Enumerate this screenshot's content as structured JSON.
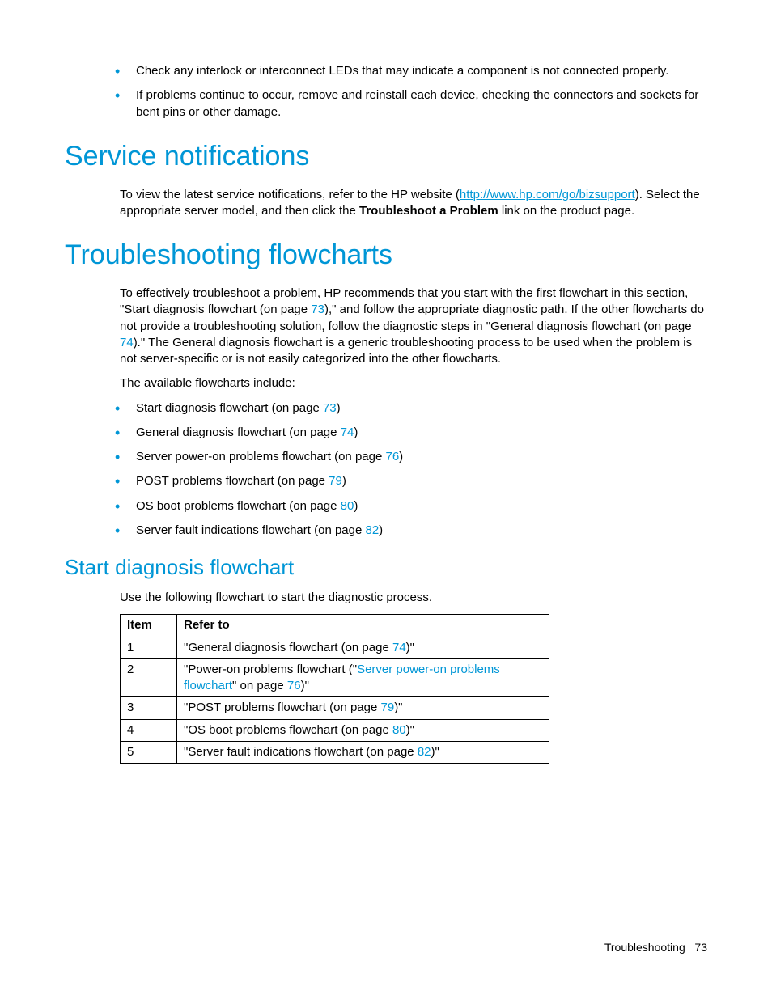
{
  "top_bullets": [
    "Check any interlock or interconnect LEDs that may indicate a component is not connected properly.",
    "If problems continue to occur, remove and reinstall each device, checking the connectors and sockets for bent pins or other damage."
  ],
  "section_service": {
    "heading": "Service notifications",
    "p1_a": "To view the latest service notifications, refer to the HP website (",
    "p1_link": "http://www.hp.com/go/bizsupport",
    "p1_b": "). Select the appropriate server model, and then click the ",
    "p1_bold": "Troubleshoot a Problem",
    "p1_c": " link on the product page."
  },
  "section_trouble": {
    "heading": "Troubleshooting flowcharts",
    "p1_a": "To effectively troubleshoot a problem, HP recommends that you start with the first flowchart in this section, \"Start diagnosis flowchart (on page ",
    "p1_ref1": "73",
    "p1_b": "),\" and follow the appropriate diagnostic path. If the other flowcharts do not provide a troubleshooting solution, follow the diagnostic steps in \"General diagnosis flowchart (on page ",
    "p1_ref2": "74",
    "p1_c": ").\" The General diagnosis flowchart is a generic troubleshooting process to be used when the problem is not server-specific or is not easily categorized into the other flowcharts.",
    "p2": "The available flowcharts include:",
    "list": [
      {
        "text": "Start diagnosis flowchart (on page ",
        "ref": "73",
        "suffix": ")"
      },
      {
        "text": "General diagnosis flowchart (on page ",
        "ref": "74",
        "suffix": ")"
      },
      {
        "text": "Server power-on problems flowchart (on page ",
        "ref": "76",
        "suffix": ")"
      },
      {
        "text": "POST problems flowchart (on page ",
        "ref": "79",
        "suffix": ")"
      },
      {
        "text": "OS boot problems flowchart (on page ",
        "ref": "80",
        "suffix": ")"
      },
      {
        "text": "Server fault indications flowchart (on page ",
        "ref": "82",
        "suffix": ")"
      }
    ]
  },
  "section_start": {
    "heading": "Start diagnosis flowchart",
    "p1": "Use the following flowchart to start the diagnostic process.",
    "th_item": "Item",
    "th_refer": "Refer to",
    "rows": [
      {
        "item": "1",
        "a": "\"General diagnosis flowchart (on page ",
        "ref": "74",
        "b": ")\""
      },
      {
        "item": "2",
        "a": "\"Power-on problems flowchart (\"",
        "link": "Server power-on problems flowchart",
        "mid": "\" on page ",
        "ref": "76",
        "b": ")\""
      },
      {
        "item": "3",
        "a": "\"POST problems flowchart (on page ",
        "ref": "79",
        "b": ")\""
      },
      {
        "item": "4",
        "a": "\"OS boot problems flowchart (on page ",
        "ref": "80",
        "b": ")\""
      },
      {
        "item": "5",
        "a": "\"Server fault indications flowchart (on page ",
        "ref": "82",
        "b": ")\""
      }
    ]
  },
  "footer": {
    "section": "Troubleshooting",
    "page": "73"
  }
}
